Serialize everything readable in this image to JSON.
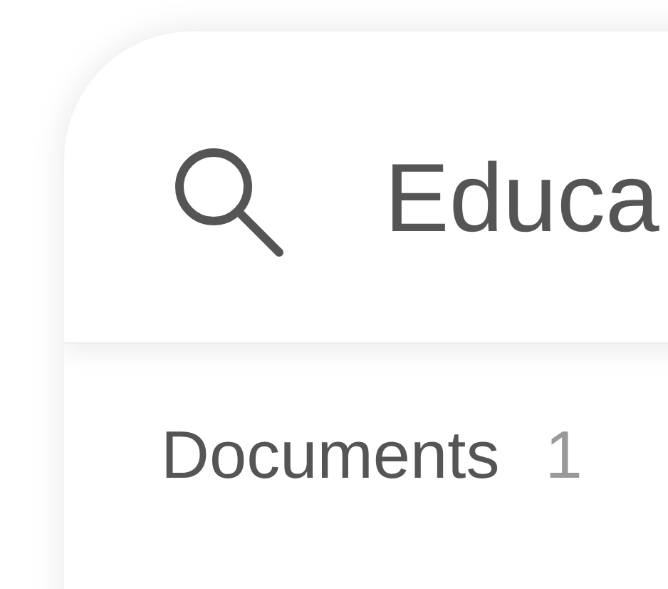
{
  "search": {
    "value": "Educa"
  },
  "section": {
    "title": "Documents",
    "count": "1"
  }
}
